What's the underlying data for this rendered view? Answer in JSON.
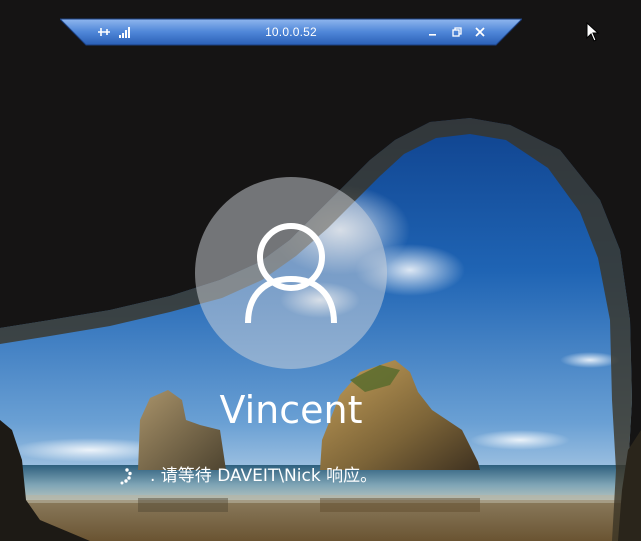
{
  "remote_session": {
    "host_address": "10.0.0.52",
    "pin_icon": "pin-icon",
    "signal_icon": "connection-quality-icon",
    "minimize_icon": "minimize-icon",
    "restore_icon": "restore-icon",
    "close_icon": "close-icon"
  },
  "lock_screen": {
    "user_name": "Vincent",
    "avatar_icon": "user-avatar-icon",
    "status_message": ". 请等待 DAVEIT\\Nick 响应。",
    "spinner_icon": "loading-spinner-icon"
  },
  "colors": {
    "bar_top": "#7aa8e8",
    "bar_bottom": "#2f6cc8",
    "avatar_fill": "rgba(210,214,220,0.50)",
    "text": "#ffffff"
  }
}
